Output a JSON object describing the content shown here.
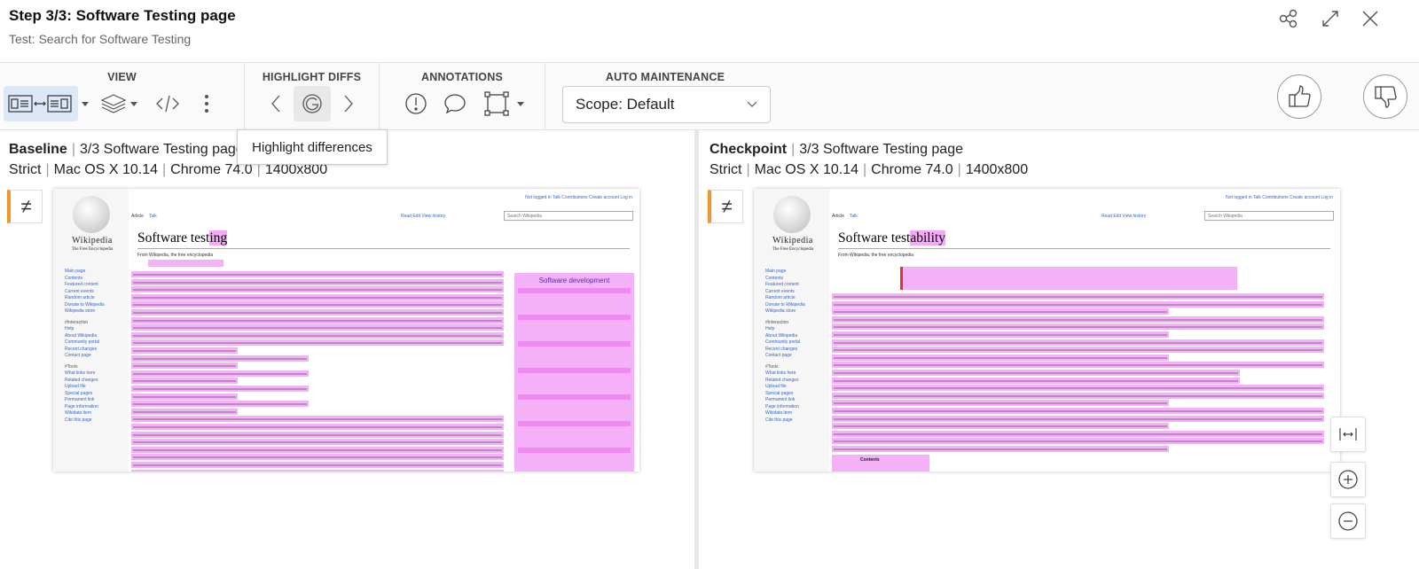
{
  "header": {
    "title": "Step 3/3: Software Testing page",
    "subtitle": "Test: Search for Software Testing",
    "icons": [
      "share-icon",
      "expand-icon",
      "close-icon"
    ]
  },
  "toolbar": {
    "view_label": "VIEW",
    "highlight_label": "HIGHLIGHT DIFFS",
    "annotations_label": "ANNOTATIONS",
    "auto_label": "AUTO MAINTENANCE",
    "scope_value": "Scope: Default",
    "tooltip": "Highlight differences"
  },
  "colors": {
    "accent": "#f0962a",
    "highlight": "#eb64f0",
    "active_view_bg": "#dce8f8"
  },
  "baseline": {
    "name": "Baseline",
    "step": "3/3 Software Testing page",
    "match": "Strict",
    "os": "Mac OS X 10.14",
    "browser": "Chrome 74.0",
    "viewport": "1400x800",
    "diff_symbol": "≠",
    "wiki": {
      "logo": "Wikipedia",
      "logo_sub": "The Free Encyclopedia",
      "title_plain": "Software test",
      "title_diff": "ing",
      "from": "From Wikipedia, the free encyclopedia",
      "tab_article": "Article",
      "tab_talk": "Talk",
      "tabs_right": "Read   Edit   View history",
      "search": "Search Wikipedia",
      "top_links": "Not logged in  Talk  Contributions  Create account  Log in",
      "box_title": "Software development"
    }
  },
  "checkpoint": {
    "name": "Checkpoint",
    "step": "3/3 Software Testing page",
    "match": "Strict",
    "os": "Mac OS X 10.14",
    "browser": "Chrome 74.0",
    "viewport": "1400x800",
    "diff_symbol": "≠",
    "wiki": {
      "logo": "Wikipedia",
      "logo_sub": "The Free Encyclopedia",
      "title_plain": "Software test",
      "title_diff": "ability",
      "from": "From Wikipedia, the free encyclopedia",
      "tab_article": "Article",
      "tab_talk": "Talk",
      "tabs_right": "Read   Edit   View history",
      "search": "Search Wikipedia",
      "top_links": "Not logged in  Talk  Contributions  Create account  Log in",
      "contents": "Contents"
    }
  },
  "wiki_sidebar": [
    "Main page",
    "Contents",
    "Featured content",
    "Current events",
    "Random article",
    "Donate to Wikipedia",
    "Wikipedia store",
    "#Interaction",
    "Help",
    "About Wikipedia",
    "Community portal",
    "Recent changes",
    "Contact page",
    "#Tools",
    "What links here",
    "Related changes",
    "Upload file",
    "Special pages",
    "Permanent link",
    "Page information",
    "Wikidata item",
    "Cite this page"
  ]
}
